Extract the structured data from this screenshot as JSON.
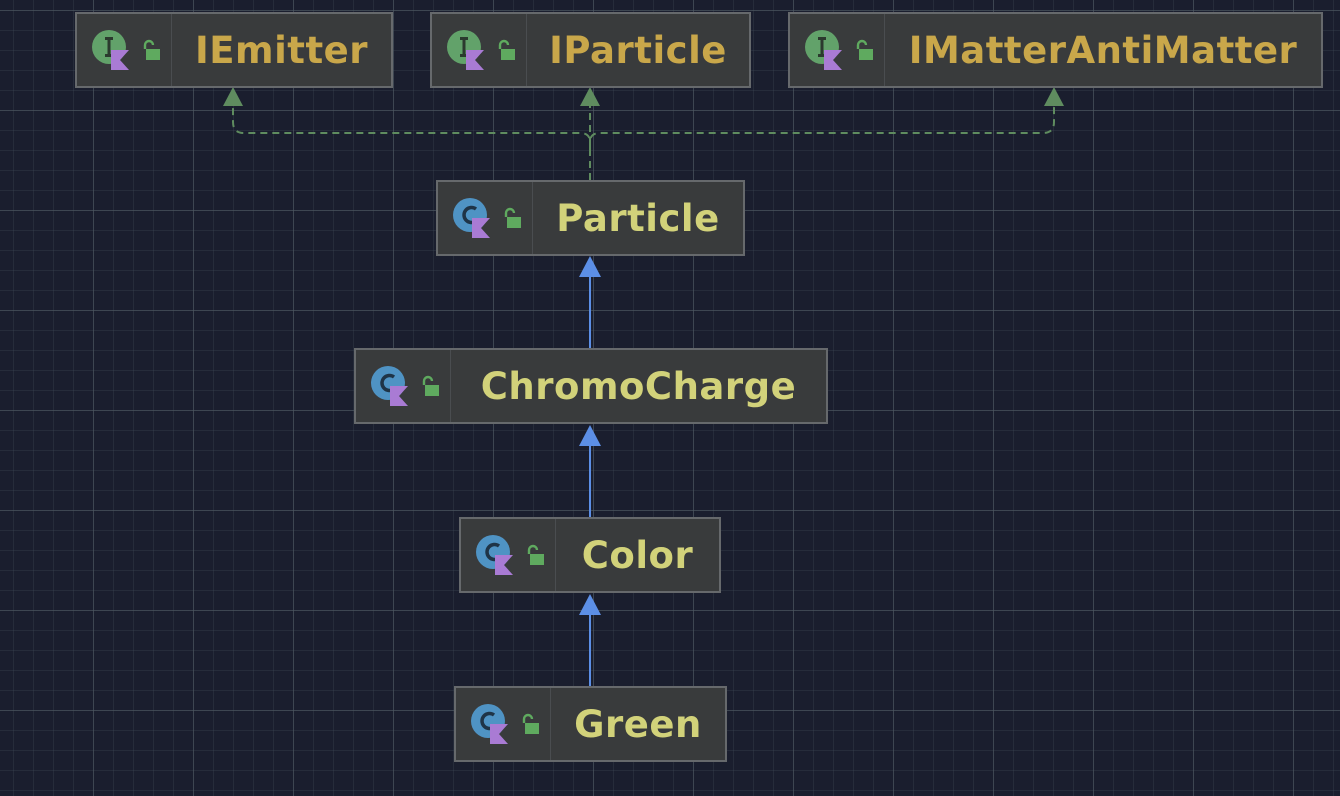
{
  "diagram": {
    "nodes": [
      {
        "id": "iemitter",
        "label": "IEmitter",
        "kind": "interface",
        "kind_icon": "interface-icon",
        "visibility_icon": "public-lock-icon"
      },
      {
        "id": "iparticle",
        "label": "IParticle",
        "kind": "interface",
        "kind_icon": "interface-icon",
        "visibility_icon": "public-lock-icon"
      },
      {
        "id": "imatterantimatter",
        "label": "IMatterAntiMatter",
        "kind": "interface",
        "kind_icon": "interface-icon",
        "visibility_icon": "public-lock-icon"
      },
      {
        "id": "particle",
        "label": "Particle",
        "kind": "class",
        "kind_icon": "class-icon",
        "visibility_icon": "public-lock-icon"
      },
      {
        "id": "chromocharge",
        "label": "ChromoCharge",
        "kind": "class",
        "kind_icon": "class-icon",
        "visibility_icon": "public-lock-icon"
      },
      {
        "id": "color",
        "label": "Color",
        "kind": "class",
        "kind_icon": "class-icon",
        "visibility_icon": "public-lock-icon"
      },
      {
        "id": "green",
        "label": "Green",
        "kind": "class",
        "kind_icon": "class-icon",
        "visibility_icon": "public-lock-icon"
      }
    ],
    "edges": [
      {
        "from": "particle",
        "to": "iemitter",
        "relation": "implements",
        "style": "dashed"
      },
      {
        "from": "particle",
        "to": "iparticle",
        "relation": "implements",
        "style": "dashed"
      },
      {
        "from": "particle",
        "to": "imatterantimatter",
        "relation": "implements",
        "style": "dashed"
      },
      {
        "from": "chromocharge",
        "to": "particle",
        "relation": "extends",
        "style": "solid"
      },
      {
        "from": "color",
        "to": "chromocharge",
        "relation": "extends",
        "style": "solid"
      },
      {
        "from": "green",
        "to": "color",
        "relation": "extends",
        "style": "solid"
      }
    ]
  },
  "colors": {
    "background": "#1a1e2e",
    "node_fill": "#393b3c",
    "node_border": "#66696c",
    "interface_label": "#c9a74a",
    "class_label": "#d2d27a",
    "implements_edge": "#5f8c5f",
    "extends_edge": "#5c8fe6",
    "interface_icon": "#62a26a",
    "class_icon": "#4f93c4",
    "kotlin_badge": "#a97bd4",
    "lock": "#5faa5f"
  }
}
